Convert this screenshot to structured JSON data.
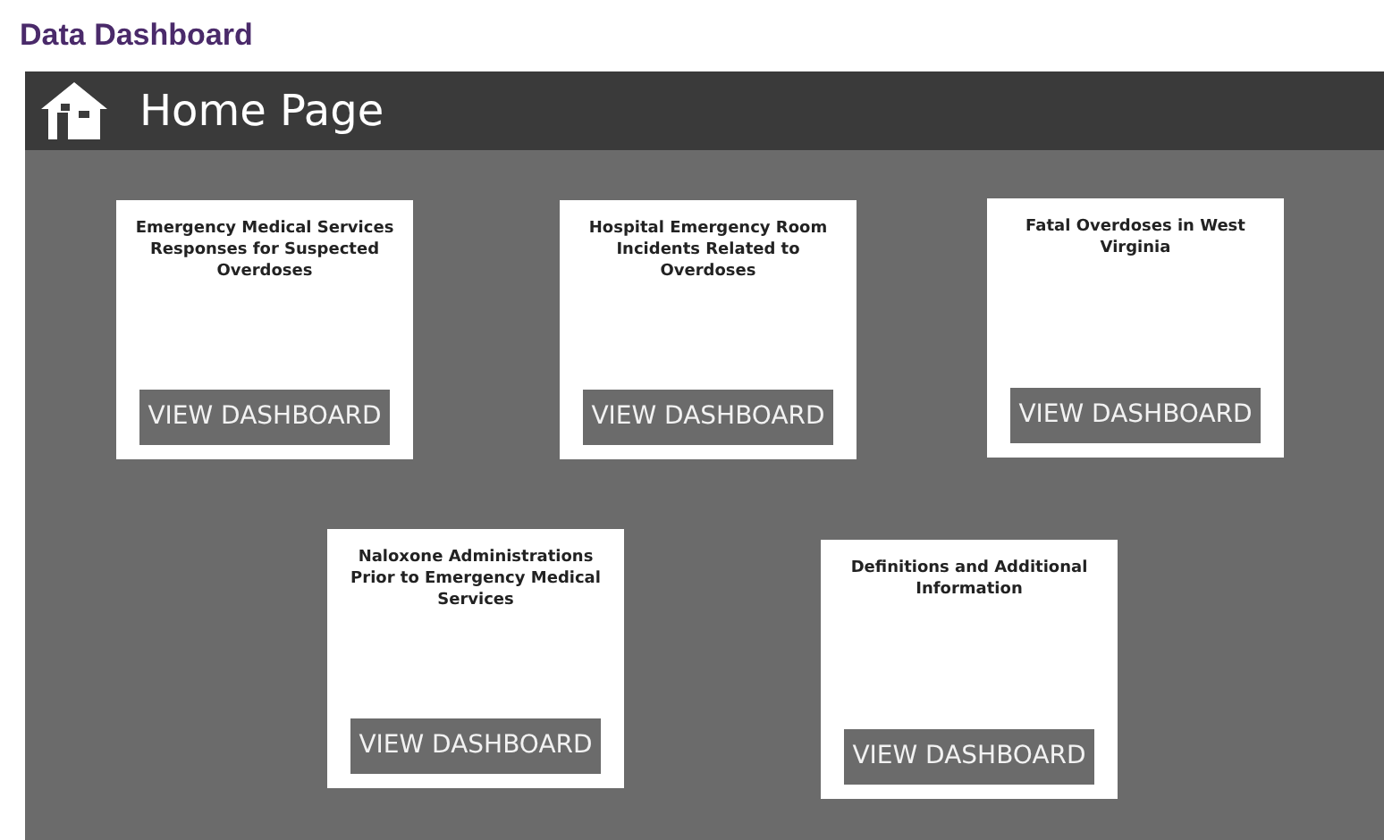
{
  "page_title": "Data Dashboard",
  "header": {
    "title": "Home Page"
  },
  "rows": [
    {
      "cards": [
        {
          "title": "Emergency Medical Services Responses for Suspected Overdoses",
          "button": "VIEW DASHBOARD"
        },
        {
          "title": "Hospital Emergency Room Incidents Related to Overdoses",
          "button": "VIEW DASHBOARD"
        },
        {
          "title": "Fatal Overdoses in West Virginia",
          "button": "VIEW DASHBOARD"
        }
      ]
    },
    {
      "cards": [
        {
          "title": "Naloxone Administrations Prior to Emergency Medical Services",
          "button": "VIEW DASHBOARD"
        },
        {
          "title": "Definitions and Additional Information",
          "button": "VIEW DASHBOARD"
        }
      ]
    }
  ]
}
